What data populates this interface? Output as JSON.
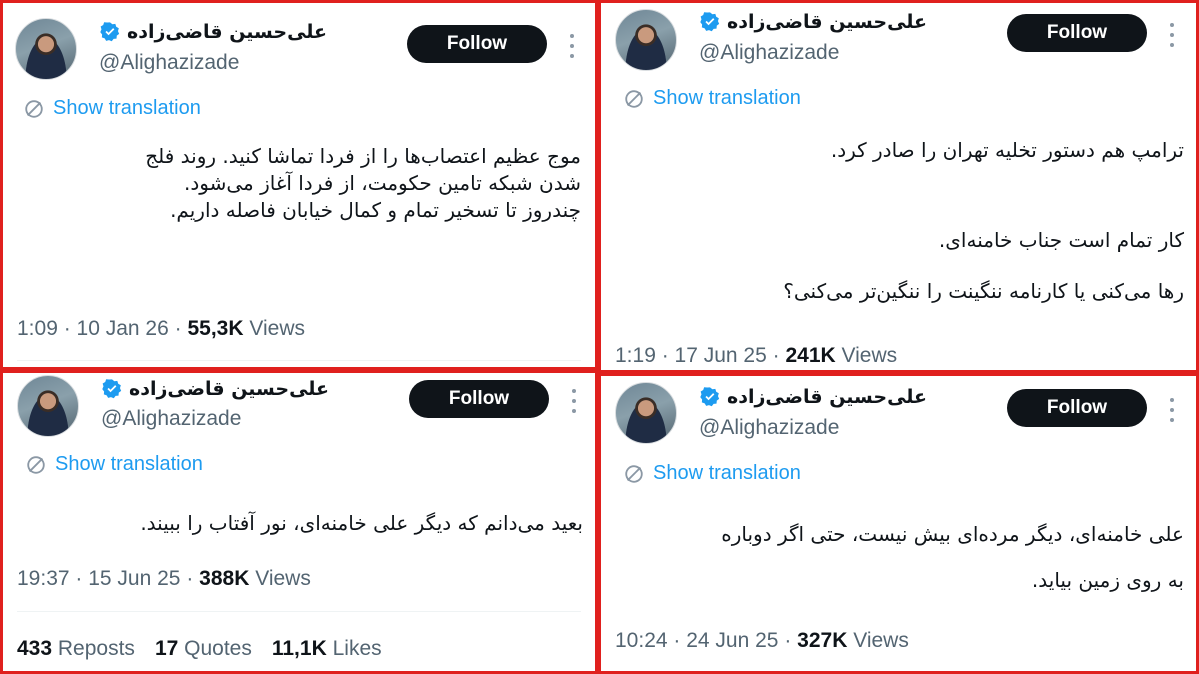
{
  "author": {
    "display_name": "علی‌حسین قاضی‌زاده",
    "handle": "@Alighazizade",
    "verified": true
  },
  "follow_label": "Follow",
  "translate_label": "Show translation",
  "colors": {
    "panel_border": "#e0201e",
    "accent": "#1d9bf0",
    "follow_bg": "#0f1419",
    "muted": "#536471"
  },
  "tweets": [
    {
      "lines": [
        "موج عظیم اعتصاب‌ها را از فردا تماشا کنید. روند فلج",
        "شدن شبکه تامین حکومت، از فردا آغاز می‌شود.",
        "چندروز تا تسخیر تمام و کمال خیابان فاصله داریم."
      ],
      "time": "1:09",
      "date": "10 Jan 26",
      "views": "55,3K",
      "views_label": "Views"
    },
    {
      "lines": [
        "ترامپ هم دستور تخلیه تهران را صادر کرد.",
        "کار تمام است جناب خامنه‌ای.",
        "رها می‌کنی یا کارنامه ننگینت را ننگین‌تر می‌کنی؟"
      ],
      "time": "1:19",
      "date": "17 Jun 25",
      "views": "241K",
      "views_label": "Views"
    },
    {
      "lines": [
        "بعید می‌دانم که دیگر علی خامنه‌ای، نور آفتاب را ببیند."
      ],
      "time": "19:37",
      "date": "15 Jun 25",
      "views": "388K",
      "views_label": "Views",
      "stats": {
        "reposts": "433",
        "reposts_label": "Reposts",
        "quotes": "17",
        "quotes_label": "Quotes",
        "likes": "11,1K",
        "likes_label": "Likes"
      }
    },
    {
      "lines": [
        "علی خامنه‌ای، دیگر مرده‌ای بیش نیست، حتی اگر دوباره",
        "به روی زمین بیاید."
      ],
      "time": "10:24",
      "date": "24 Jun 25",
      "views": "327K",
      "views_label": "Views"
    }
  ]
}
